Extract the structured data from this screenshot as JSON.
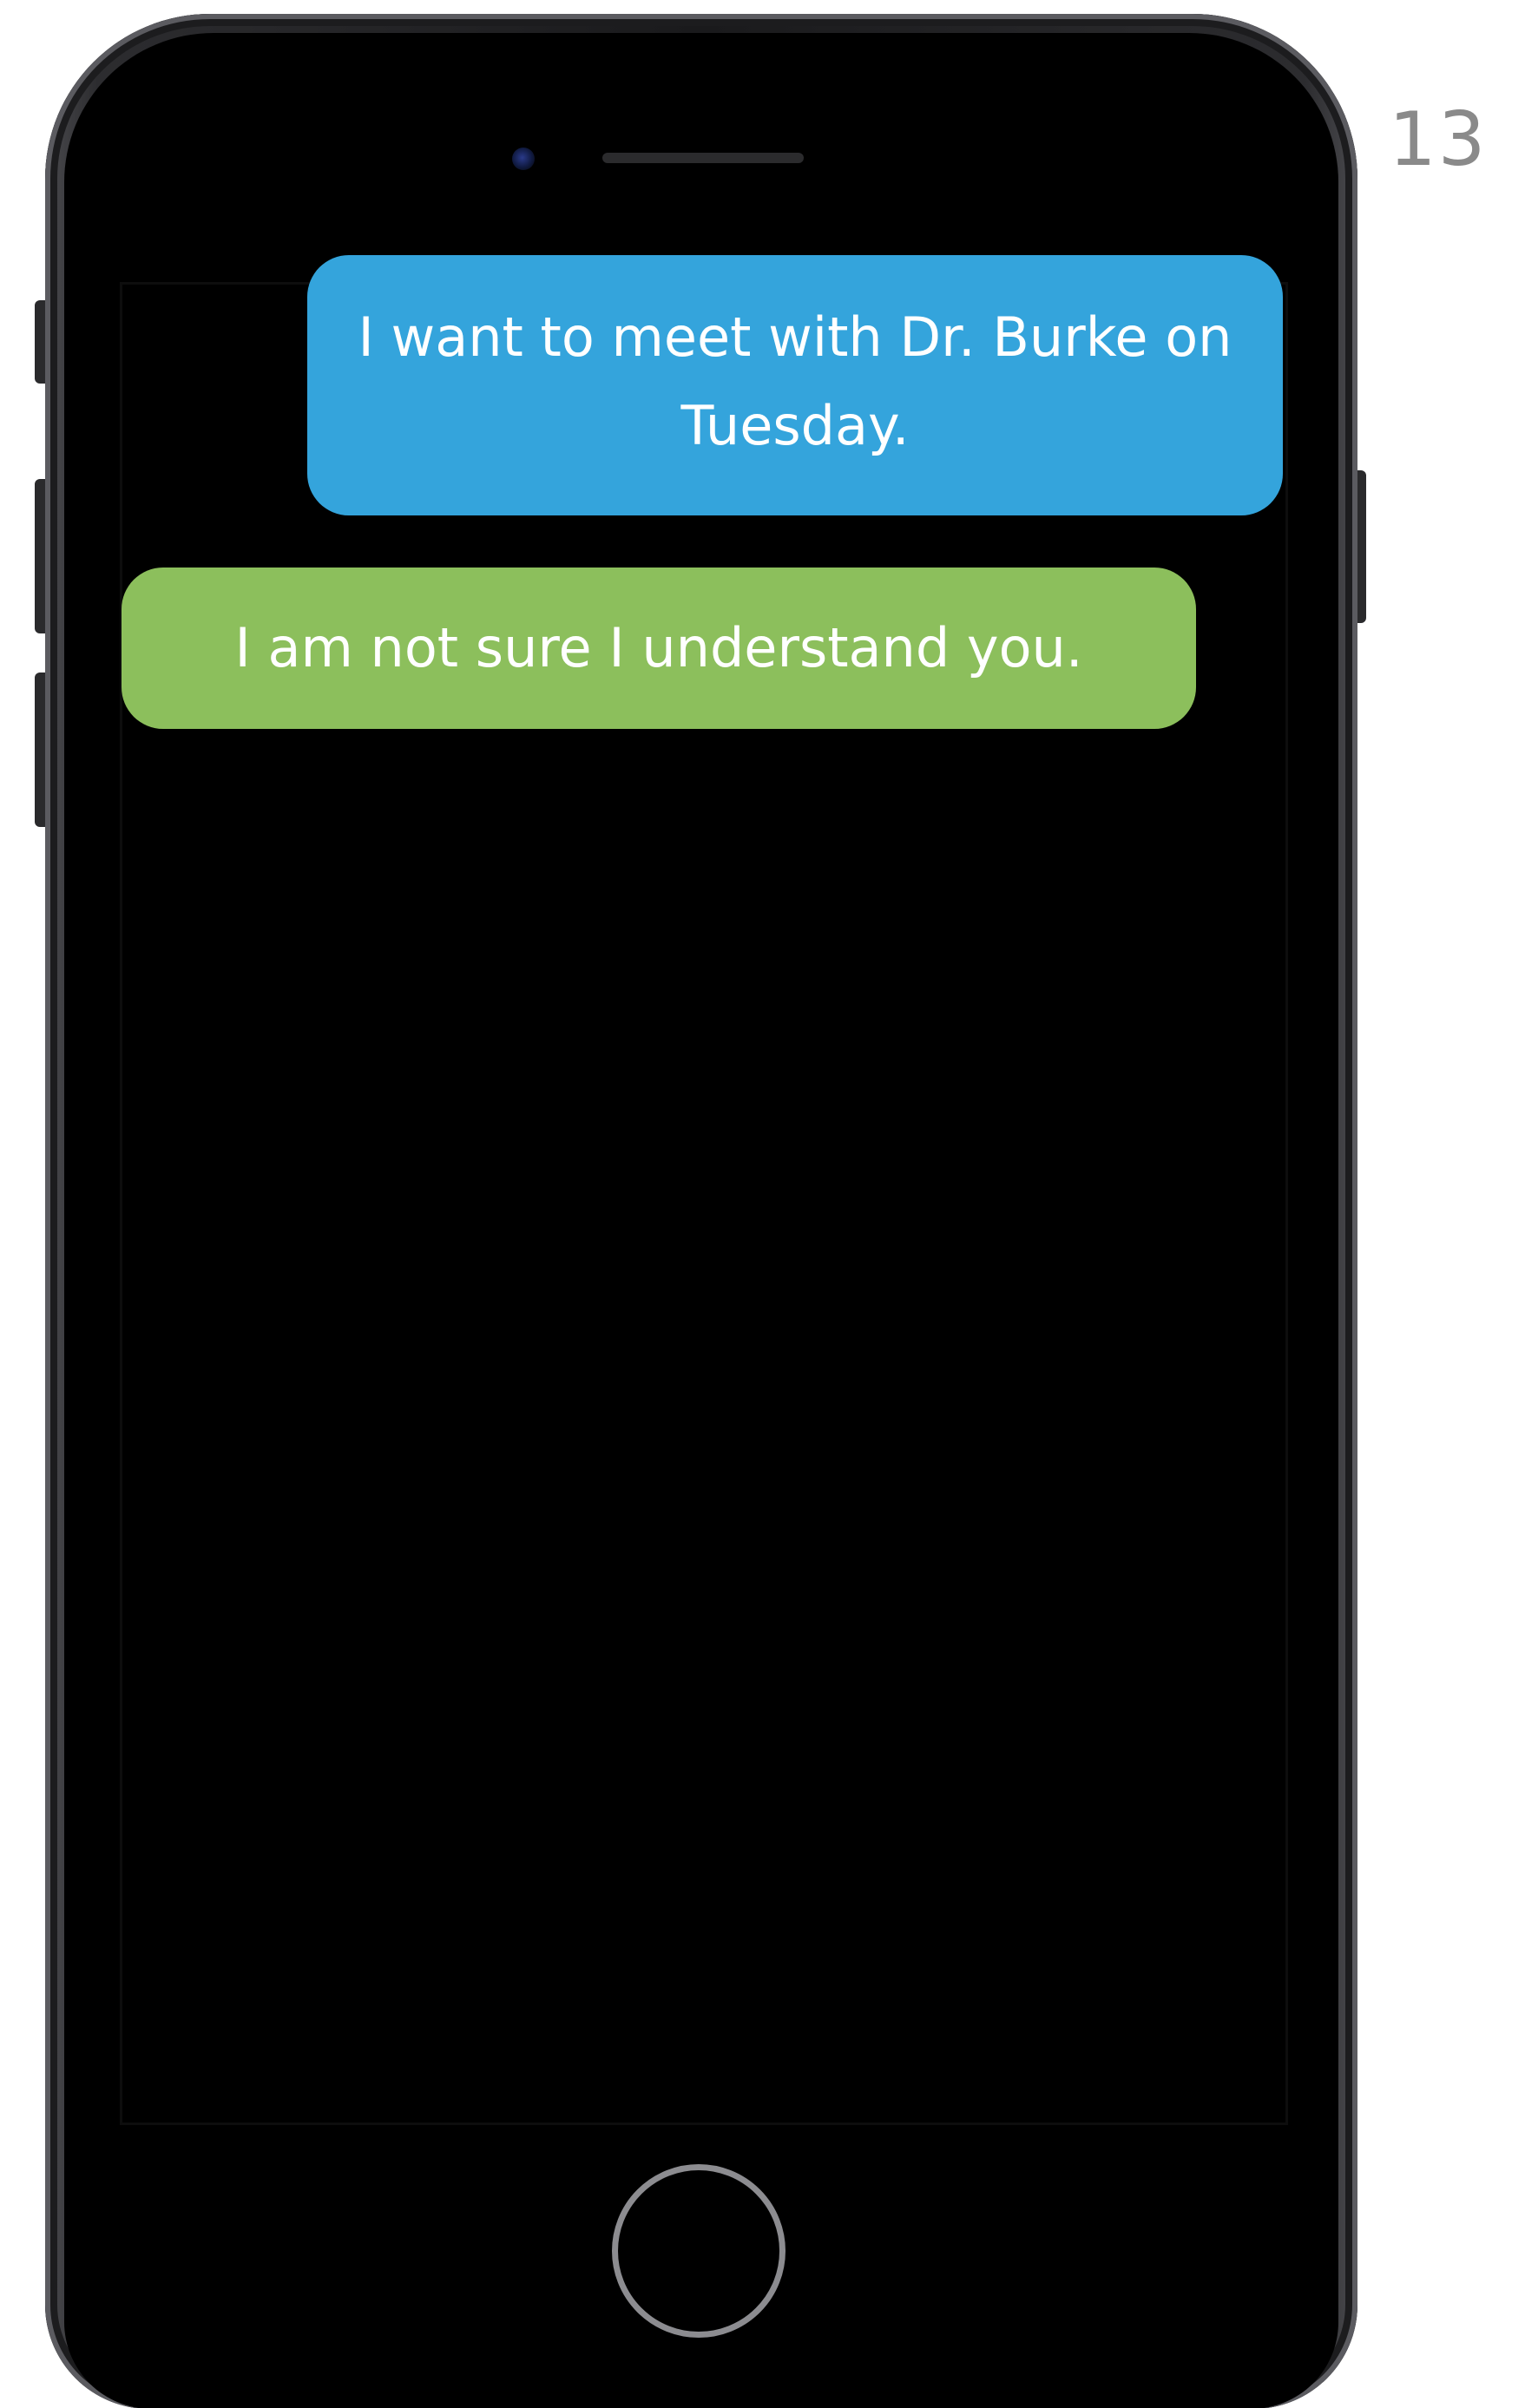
{
  "page": {
    "number": "13"
  },
  "chat": {
    "messages": [
      {
        "sender": "user",
        "text": "I want to meet with Dr. Burke on Tuesday.",
        "color": "#34a4dc"
      },
      {
        "sender": "bot",
        "text": "I am not sure I understand you.",
        "color": "#8cbf5c"
      }
    ]
  },
  "device": {
    "frame_color": "#1a1a1c",
    "screen_color": "#000000"
  }
}
